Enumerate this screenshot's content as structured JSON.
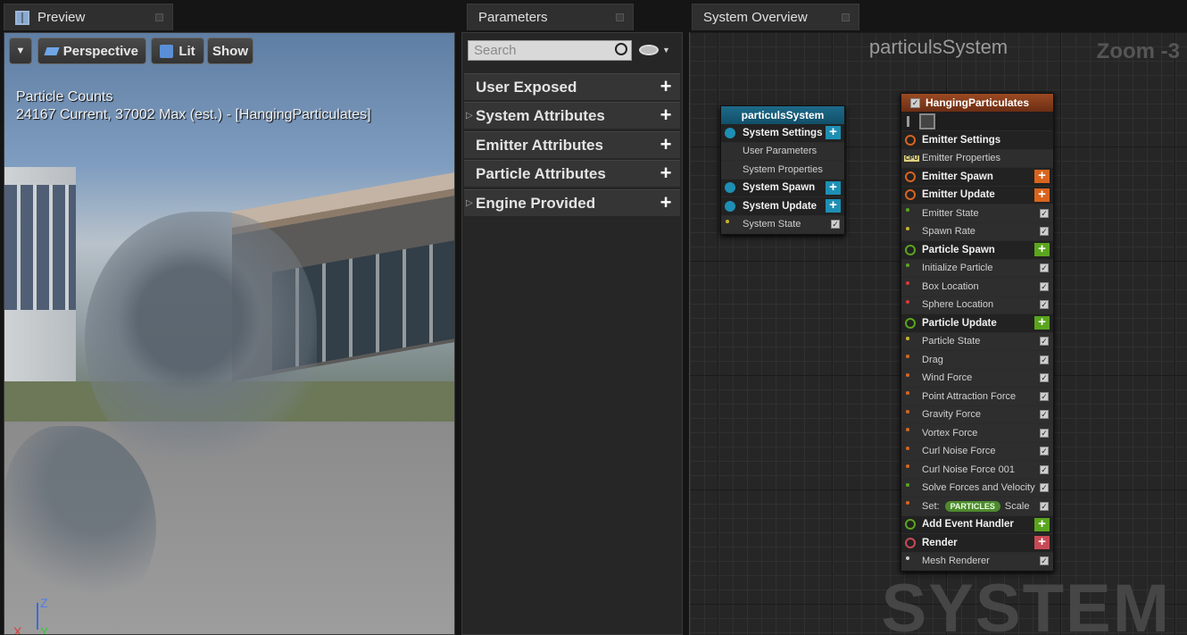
{
  "preview": {
    "tab_title": "Preview",
    "toolbar": {
      "perspective": "Perspective",
      "lit": "Lit",
      "show": "Show"
    },
    "particle_counts_title": "Particle Counts",
    "particle_counts_value": "24167 Current, 37002 Max (est.) - [HangingParticulates]",
    "axis_z": "Z",
    "axis_x": "X",
    "axis_y": "Y"
  },
  "parameters": {
    "tab_title": "Parameters",
    "search_placeholder": "Search",
    "categories": [
      {
        "label": "User Exposed"
      },
      {
        "label": "System Attributes"
      },
      {
        "label": "Emitter Attributes"
      },
      {
        "label": "Particle Attributes"
      },
      {
        "label": "Engine Provided"
      }
    ]
  },
  "overview": {
    "tab_title": "System Overview",
    "graph_title": "particulsSystem",
    "zoom": "Zoom -3",
    "watermark": "SYSTEM",
    "system_node": {
      "title": "particulsSystem",
      "rows": [
        {
          "label": "System Settings"
        },
        {
          "label": "User Parameters"
        },
        {
          "label": "System Properties"
        },
        {
          "label": "System Spawn"
        },
        {
          "label": "System Update"
        },
        {
          "label": "System State"
        }
      ]
    },
    "emitter_node": {
      "title": "HangingParticulates",
      "rows": [
        {
          "label": "Emitter Settings"
        },
        {
          "label": "Emitter Properties"
        },
        {
          "label": "Emitter Spawn"
        },
        {
          "label": "Emitter Update"
        },
        {
          "label": "Emitter State"
        },
        {
          "label": "Spawn Rate"
        },
        {
          "label": "Particle Spawn"
        },
        {
          "label": "Initialize Particle"
        },
        {
          "label": "Box Location"
        },
        {
          "label": "Sphere Location"
        },
        {
          "label": "Particle Update"
        },
        {
          "label": "Particle State"
        },
        {
          "label": "Drag"
        },
        {
          "label": "Wind Force"
        },
        {
          "label": "Point Attraction Force"
        },
        {
          "label": "Gravity Force"
        },
        {
          "label": "Vortex Force"
        },
        {
          "label": "Curl Noise Force"
        },
        {
          "label": "Curl Noise Force 001"
        },
        {
          "label": "Solve Forces and Velocity"
        },
        {
          "label": "Set:"
        },
        {
          "label": "Add Event Handler"
        },
        {
          "label": "Render"
        },
        {
          "label": "Mesh Renderer"
        }
      ],
      "set_badge": "PARTICLES",
      "set_suffix": "Scale",
      "cpu_badge": "CPU"
    }
  },
  "colors": {
    "accent_blue": "#1e8fb4",
    "orange": "#d9641e",
    "green": "#5aa51e",
    "red": "#c84a55"
  }
}
